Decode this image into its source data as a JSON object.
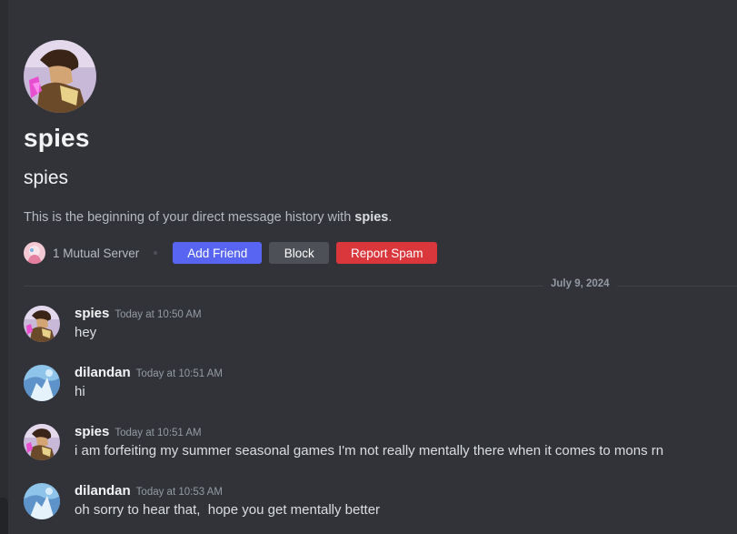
{
  "profile": {
    "display_name": "spies",
    "username": "spies",
    "intro_prefix": "This is the beginning of your direct message history with ",
    "intro_name": "spies",
    "intro_suffix": "."
  },
  "actions": {
    "mutual_servers": "1 Mutual Server",
    "add_friend": "Add Friend",
    "block": "Block",
    "report_spam": "Report Spam"
  },
  "divider": {
    "date": "July 9, 2024"
  },
  "messages": [
    {
      "author": "spies",
      "time": "Today at 10:50 AM",
      "text": "hey",
      "avatar": "spies-avatar"
    },
    {
      "author": "dilandan",
      "time": "Today at 10:51 AM",
      "text": "hi",
      "avatar": "dilandan-avatar"
    },
    {
      "author": "spies",
      "time": "Today at 10:51 AM",
      "text": "i am forfeiting my summer seasonal games I'm not really mentally there when it comes to mons rn",
      "avatar": "spies-avatar"
    },
    {
      "author": "dilandan",
      "time": "Today at 10:53 AM",
      "text": "oh sorry to hear that,  hope you get mentally better",
      "avatar": "dilandan-avatar"
    }
  ],
  "colors": {
    "background": "#313338",
    "add_friend": "#5865f2",
    "block": "#4e5058",
    "report_spam": "#da373c"
  }
}
